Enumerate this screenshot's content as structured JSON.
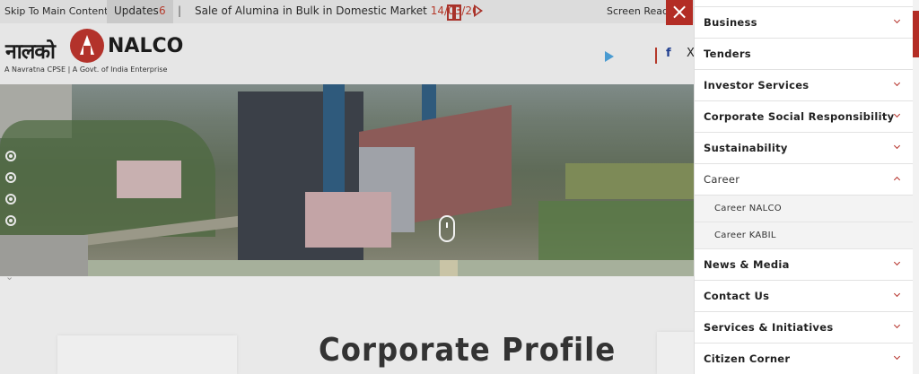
{
  "topbar": {
    "skip_link": "Skip To Main Content",
    "updates_label": "Updates",
    "updates_count": "6",
    "separator": "|",
    "ticker_text": "Sale of Alumina in Bulk in Domestic Market",
    "ticker_date": "14/03/20",
    "pause_icon": "pause-icon",
    "play_icon": "play-icon",
    "screen_reader": "Screen Reader"
  },
  "header": {
    "logo_hindi": "नालको",
    "logo_english": "NALCO",
    "tagline": "A Navratna CPSE | A Govt. of India Enterprise",
    "social": {
      "google_play": "google-play-icon",
      "apple": "apple-icon",
      "apple_glyph": "",
      "facebook_glyph": "f",
      "x_glyph": "X"
    }
  },
  "close_button": "×",
  "side_menu": {
    "items": [
      {
        "label": "Business",
        "expanded": false
      },
      {
        "label": "Tenders",
        "expanded": false
      },
      {
        "label": "Investor Services",
        "expanded": false
      },
      {
        "label": "Corporate Social Responsibility",
        "expanded": false
      },
      {
        "label": "Sustainability",
        "expanded": false
      },
      {
        "label": "Career",
        "expanded": true
      },
      {
        "label": "News & Media",
        "expanded": false
      },
      {
        "label": "Contact Us",
        "expanded": false
      },
      {
        "label": "Services & Initiatives",
        "expanded": false
      },
      {
        "label": "Citizen Corner",
        "expanded": false
      }
    ],
    "career_subitems": [
      "Career NALCO",
      "Career KABIL"
    ]
  },
  "main": {
    "section_title": "Corporate Profile"
  },
  "colors": {
    "accent": "#b32d25",
    "topbar_bg": "#dcdcdc"
  }
}
